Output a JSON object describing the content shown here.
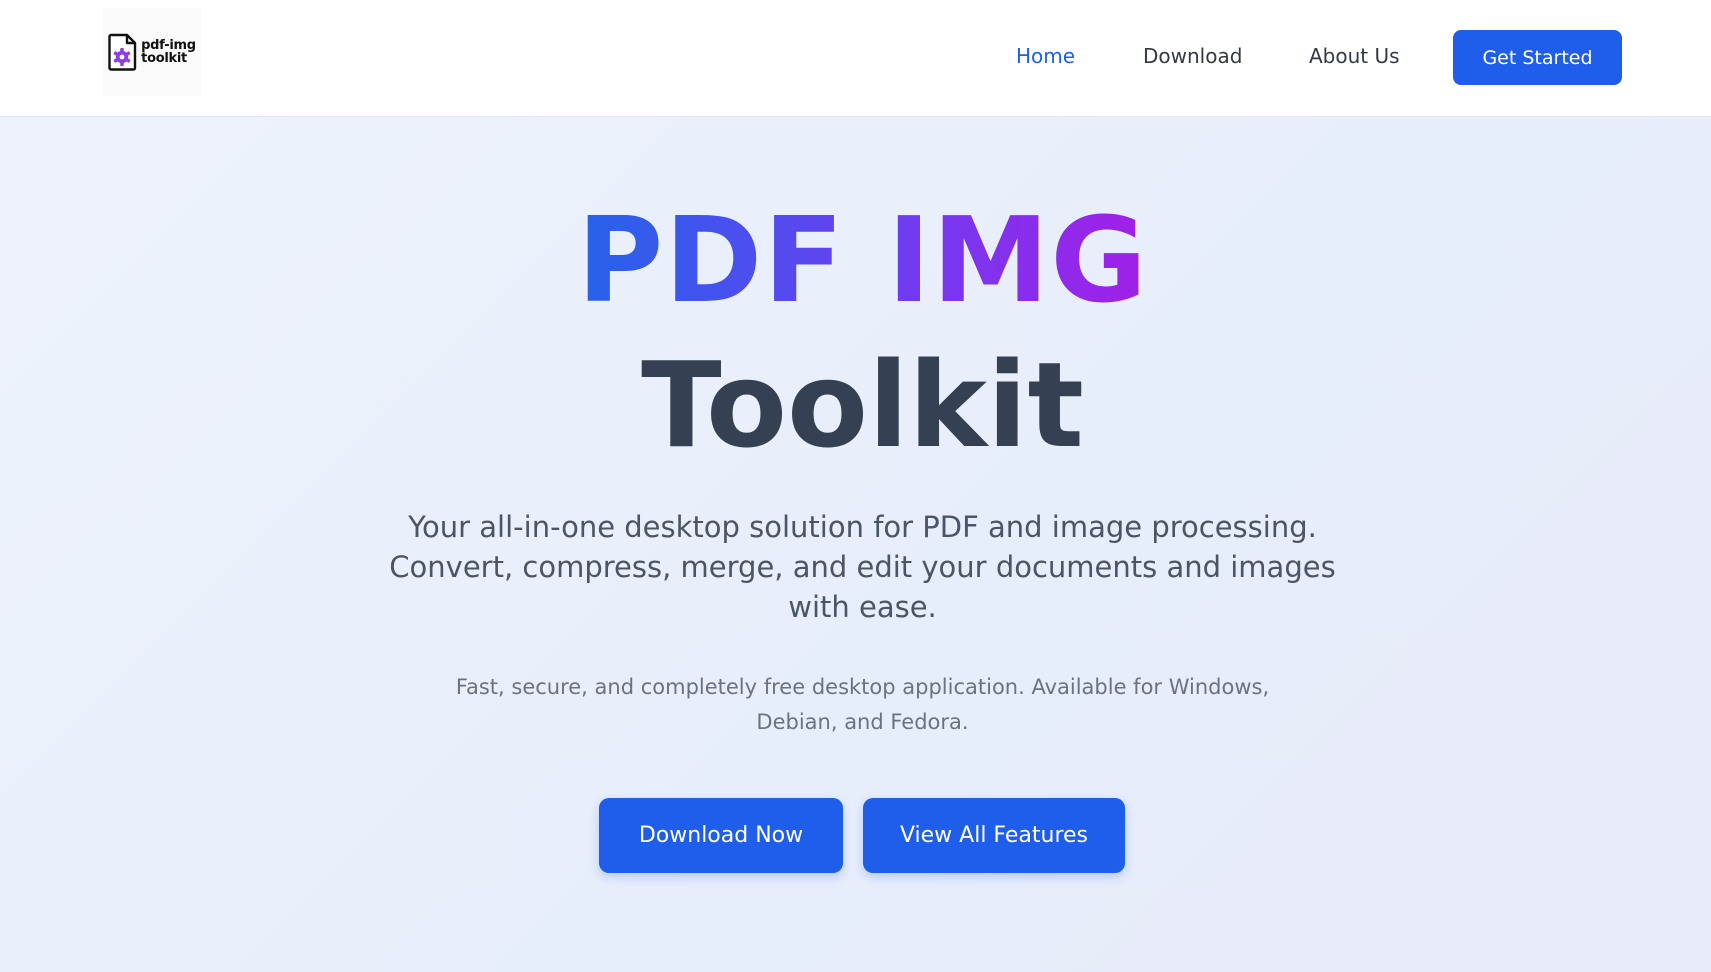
{
  "brand": {
    "logo_line1": "pdf-img",
    "logo_line2": "toolkit",
    "logo_icon": "document-gear-icon"
  },
  "nav": {
    "items": [
      {
        "label": "Home",
        "active": true
      },
      {
        "label": "Download",
        "active": false
      },
      {
        "label": "About Us",
        "active": false
      }
    ],
    "cta_label": "Get Started"
  },
  "hero": {
    "title_gradient": "PDF IMG",
    "title_plain": "Toolkit",
    "subtitle": "Your all-in-one desktop solution for PDF and image processing. Convert, compress, merge, and edit your documents and images with ease.",
    "note": "Fast, secure, and completely free desktop application. Available for Windows, Debian, and Fedora.",
    "primary_button": "Download Now",
    "secondary_button": "View All Features"
  },
  "colors": {
    "accent": "#1f5eea",
    "heading": "#354152",
    "gradient_start": "#2563eb",
    "gradient_end": "#a21fe8"
  }
}
